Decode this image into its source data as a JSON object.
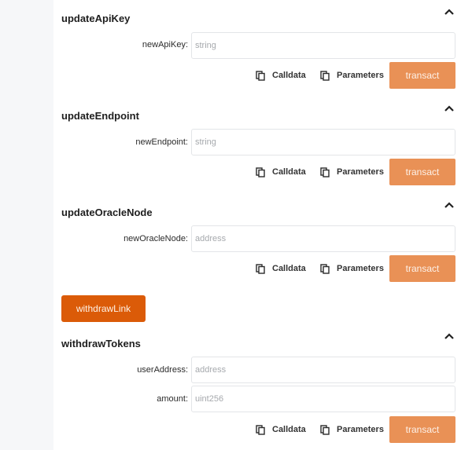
{
  "functions": [
    {
      "name": "updateApiKey",
      "params": [
        {
          "label": "newApiKey:",
          "placeholder": "string"
        }
      ],
      "calldata_label": "Calldata",
      "parameters_label": "Parameters",
      "transact_label": "transact"
    },
    {
      "name": "updateEndpoint",
      "params": [
        {
          "label": "newEndpoint:",
          "placeholder": "string"
        }
      ],
      "calldata_label": "Calldata",
      "parameters_label": "Parameters",
      "transact_label": "transact"
    },
    {
      "name": "updateOracleNode",
      "params": [
        {
          "label": "newOracleNode:",
          "placeholder": "address"
        }
      ],
      "calldata_label": "Calldata",
      "parameters_label": "Parameters",
      "transact_label": "transact"
    },
    {
      "name": "withdrawTokens",
      "params": [
        {
          "label": "userAddress:",
          "placeholder": "address"
        },
        {
          "label": "amount:",
          "placeholder": "uint256"
        }
      ],
      "calldata_label": "Calldata",
      "parameters_label": "Parameters",
      "transact_label": "transact"
    }
  ],
  "withdrawLink": {
    "label": "withdrawLink"
  },
  "icons": {
    "collapse": "chevron-up-icon",
    "copy": "copy-icon"
  },
  "colors": {
    "transact": "#e99156",
    "withdraw_button": "#db5b08",
    "panel": "#ffffff",
    "background": "#f6f7f9"
  }
}
